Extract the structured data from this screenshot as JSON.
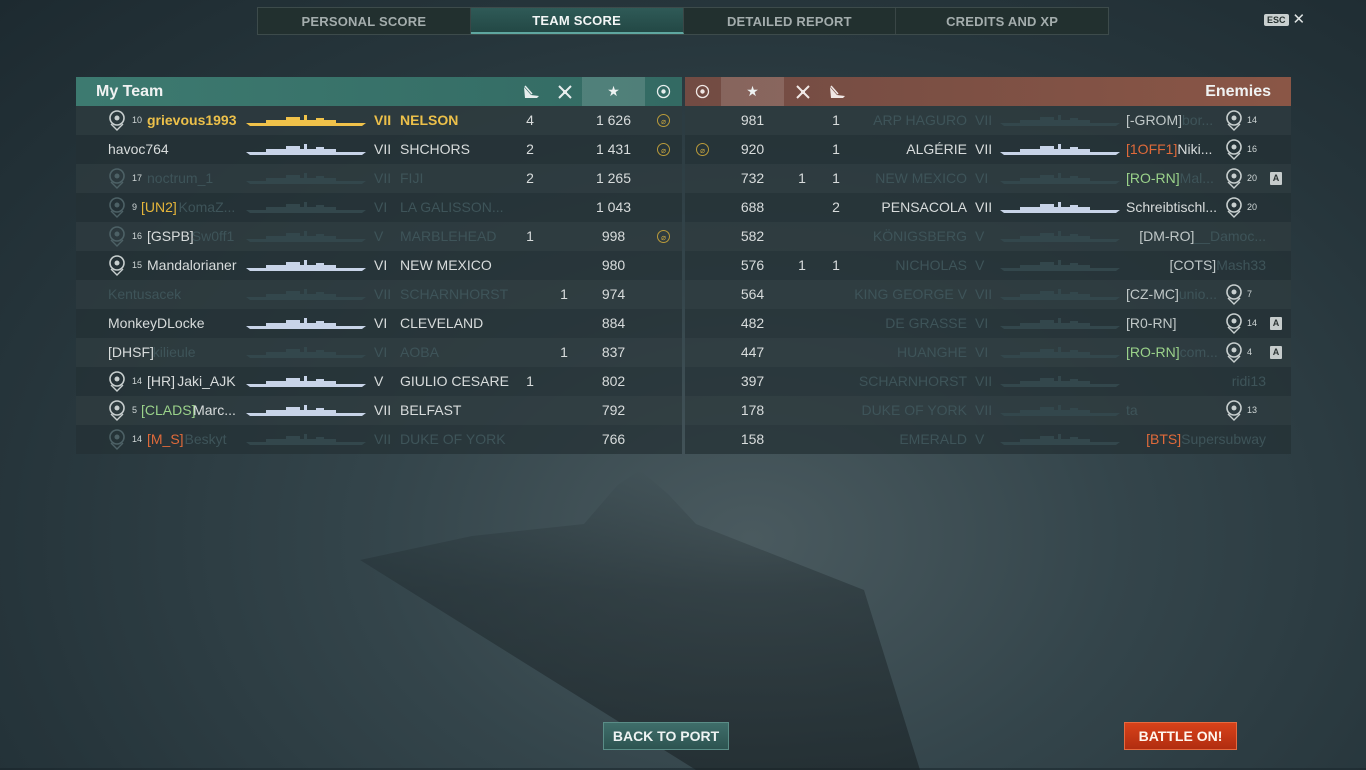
{
  "tabs": [
    "PERSONAL SCORE",
    "TEAM SCORE",
    "DETAILED REPORT",
    "CREDITS AND XP"
  ],
  "active_tab": 1,
  "esc": {
    "key": "ESC",
    "close": "✕"
  },
  "my_team": {
    "title": "My Team",
    "rows": [
      {
        "rank": "10",
        "clan": "",
        "name": "grievous1993",
        "tier": "VII",
        "ship": "NELSON",
        "col1": "4",
        "col2": "",
        "score": "1 626",
        "medal": true,
        "style": "gold",
        "dead": false,
        "rank_icon": true
      },
      {
        "rank": "",
        "clan": "",
        "name": "havoc764",
        "tier": "VII",
        "ship": "SHCHORS",
        "col1": "2",
        "col2": "",
        "score": "1 431",
        "medal": true,
        "style": "",
        "dead": false,
        "rank_icon": false
      },
      {
        "rank": "17",
        "clan": "",
        "name": "noctrum_1",
        "tier": "VII",
        "ship": "FIJI",
        "col1": "2",
        "col2": "",
        "score": "1 265",
        "medal": false,
        "style": "",
        "dead": true,
        "rank_icon": true
      },
      {
        "rank": "9",
        "clan": "[UN2]",
        "name": "KomaZ...",
        "tier": "VI",
        "ship": "LA GALISSON...",
        "col1": "",
        "col2": "",
        "score": "1 043",
        "medal": false,
        "style": "",
        "dead": true,
        "clan_color": "clan-y",
        "rank_icon": true
      },
      {
        "rank": "16",
        "clan": "[GSPB]",
        "name": "Sw0ff1",
        "tier": "V",
        "ship": "MARBLEHEAD",
        "col1": "1",
        "col2": "",
        "score": "998",
        "medal": true,
        "style": "",
        "dead": true,
        "clan_color": "",
        "rank_icon": true
      },
      {
        "rank": "15",
        "clan": "",
        "name": "Mandalorianer",
        "tier": "VI",
        "ship": "NEW MEXICO",
        "col1": "",
        "col2": "",
        "score": "980",
        "medal": false,
        "style": "",
        "dead": false,
        "rank_icon": true
      },
      {
        "rank": "",
        "clan": "",
        "name": "Kentusacek",
        "tier": "VII",
        "ship": "SCHARNHORST",
        "col1": "",
        "col2": "1",
        "score": "974",
        "medal": false,
        "style": "",
        "dead": true,
        "rank_icon": false
      },
      {
        "rank": "",
        "clan": "",
        "name": "MonkeyDLocke",
        "tier": "VI",
        "ship": "CLEVELAND",
        "col1": "",
        "col2": "",
        "score": "884",
        "medal": false,
        "style": "",
        "dead": false,
        "rank_icon": false
      },
      {
        "rank": "",
        "clan": "[DHSF]",
        "name": "kilieule",
        "tier": "VI",
        "ship": "AOBA",
        "col1": "",
        "col2": "1",
        "score": "837",
        "medal": false,
        "style": "",
        "dead": true,
        "clan_color": "",
        "rank_icon": false
      },
      {
        "rank": "14",
        "clan": "[HR]",
        "name": "Jaki_AJK",
        "tier": "V",
        "ship": "GIULIO CESARE",
        "col1": "1",
        "col2": "",
        "score": "802",
        "medal": false,
        "style": "",
        "dead": false,
        "clan_color": "",
        "rank_icon": true
      },
      {
        "rank": "5",
        "clan": "[CLADS]",
        "name": "Marc...",
        "tier": "VII",
        "ship": "BELFAST",
        "col1": "",
        "col2": "",
        "score": "792",
        "medal": false,
        "style": "",
        "dead": false,
        "clan_color": "clan-g",
        "rank_icon": true
      },
      {
        "rank": "14",
        "clan": "[M_S]",
        "name": "Beskyt",
        "tier": "VII",
        "ship": "DUKE OF YORK",
        "col1": "",
        "col2": "",
        "score": "766",
        "medal": false,
        "style": "",
        "dead": true,
        "clan_color": "clan-o",
        "rank_icon": true
      }
    ]
  },
  "enemies": {
    "title": "Enemies",
    "rows": [
      {
        "medal": false,
        "score": "981",
        "col2": "",
        "col1": "1",
        "ship": "ARP HAGURO",
        "tier": "VII",
        "clan": "[-GROM]",
        "name": "bor...",
        "rank": "14",
        "dead": true,
        "flag": false,
        "rank_icon": true
      },
      {
        "medal": true,
        "score": "920",
        "col2": "",
        "col1": "1",
        "ship": "ALGÉRIE",
        "tier": "VII",
        "clan": "[1OFF1]",
        "name": "Niki...",
        "rank": "16",
        "dead": false,
        "flag": false,
        "clan_color": "clan-o",
        "rank_icon": true
      },
      {
        "medal": false,
        "score": "732",
        "col2": "1",
        "col1": "1",
        "ship": "NEW MEXICO",
        "tier": "VI",
        "clan": "[RO-RN]",
        "name": "Mal...",
        "rank": "20",
        "dead": true,
        "flag": true,
        "clan_color": "clan-g",
        "rank_icon": true
      },
      {
        "medal": false,
        "score": "688",
        "col2": "",
        "col1": "2",
        "ship": "PENSACOLA",
        "tier": "VII",
        "clan": "",
        "name": "Schreibtischl...",
        "rank": "20",
        "dead": false,
        "flag": false,
        "rank_icon": true
      },
      {
        "medal": false,
        "score": "582",
        "col2": "",
        "col1": "",
        "ship": "KÖNIGSBERG",
        "tier": "V",
        "clan": "[DM-RO]",
        "name": "__Damoc...",
        "rank": "",
        "dead": true,
        "flag": false,
        "rank_icon": false
      },
      {
        "medal": false,
        "score": "576",
        "col2": "1",
        "col1": "1",
        "ship": "NICHOLAS",
        "tier": "V",
        "clan": "[COTS]",
        "name": "Mash33",
        "rank": "",
        "dead": true,
        "flag": false,
        "rank_icon": false
      },
      {
        "medal": false,
        "score": "564",
        "col2": "",
        "col1": "",
        "ship": "KING GEORGE V",
        "tier": "VII",
        "clan": "[CZ-MC]",
        "name": "unio...",
        "rank": "7",
        "dead": true,
        "flag": false,
        "rank_icon": true
      },
      {
        "medal": false,
        "score": "482",
        "col2": "",
        "col1": "",
        "ship": "DE GRASSE",
        "tier": "VI",
        "clan": "[R0-RN]",
        "name": "",
        "rank": "14",
        "dead": true,
        "flag": true,
        "rank_icon": true
      },
      {
        "medal": false,
        "score": "447",
        "col2": "",
        "col1": "",
        "ship": "HUANGHE",
        "tier": "VI",
        "clan": "[RO-RN]",
        "name": "com...",
        "rank": "4",
        "dead": true,
        "flag": true,
        "clan_color": "clan-g",
        "rank_icon": true
      },
      {
        "medal": false,
        "score": "397",
        "col2": "",
        "col1": "",
        "ship": "SCHARNHORST",
        "tier": "VII",
        "clan": "",
        "name": "ridi13",
        "rank": "",
        "dead": true,
        "flag": false,
        "rank_icon": false
      },
      {
        "medal": false,
        "score": "178",
        "col2": "",
        "col1": "",
        "ship": "DUKE OF YORK",
        "tier": "VII",
        "clan": "",
        "name": "ta",
        "rank": "13",
        "dead": true,
        "flag": false,
        "rank_icon": true
      },
      {
        "medal": false,
        "score": "158",
        "col2": "",
        "col1": "",
        "ship": "EMERALD",
        "tier": "V",
        "clan": "[BTS]",
        "name": "Supersubway",
        "rank": "",
        "dead": true,
        "flag": false,
        "clan_color": "clan-o",
        "rank_icon": false
      }
    ]
  },
  "buttons": {
    "back": "BACK TO PORT",
    "battle": "BATTLE ON!"
  },
  "icons": {
    "ship_sunk": "sunk-ship-icon",
    "planes": "plane-destroyed-icon",
    "star": "★",
    "medal": "medal-icon",
    "flag": "A"
  },
  "colors": {
    "my_header": "#3d7a70",
    "enemy_header": "#8a5646",
    "gold": "#ecc04a",
    "battle_button": "#d8421a"
  }
}
